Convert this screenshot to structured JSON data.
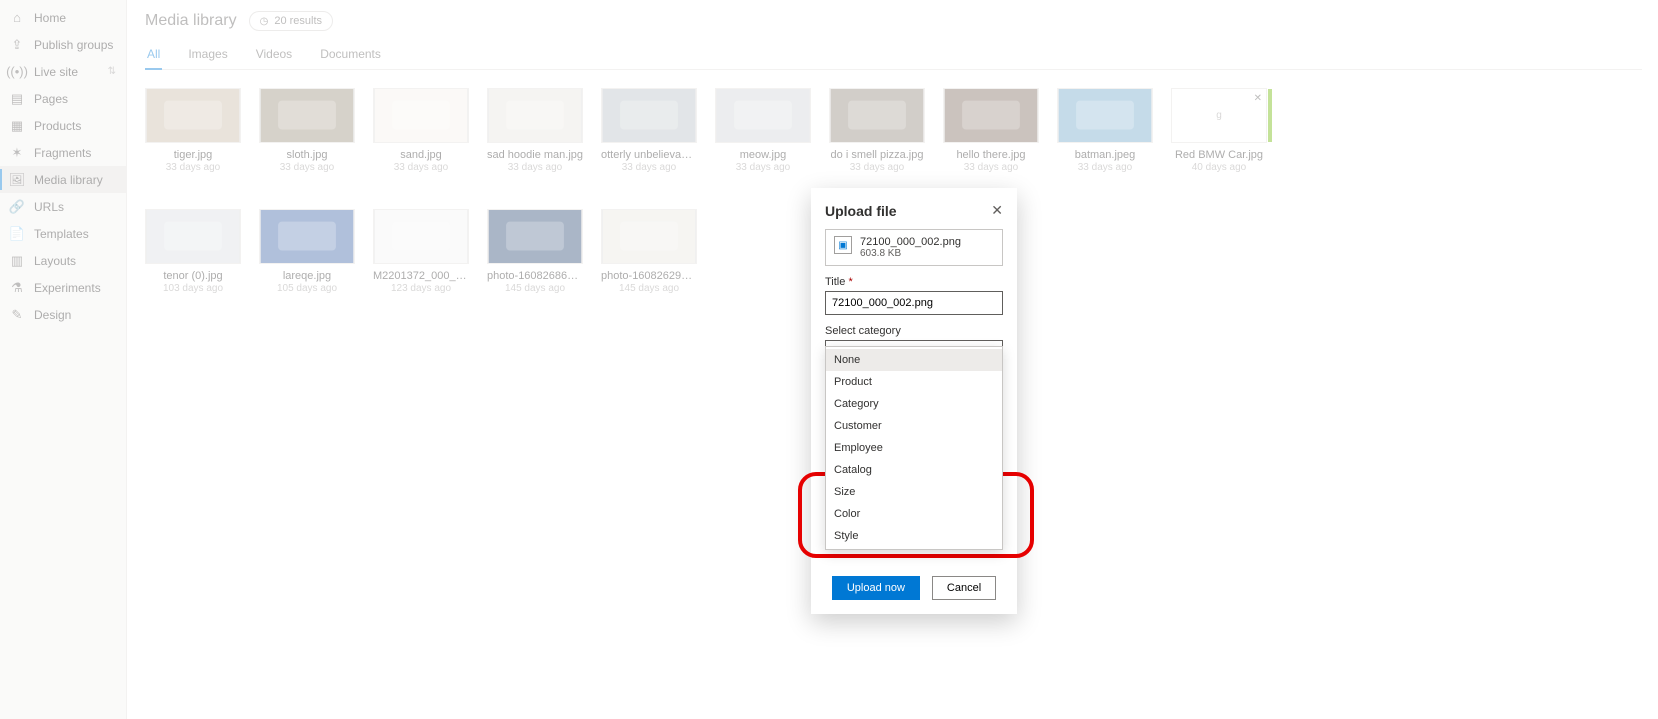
{
  "sidebar": {
    "items": [
      {
        "icon": "home-icon",
        "glyph": "⌂",
        "label": "Home"
      },
      {
        "icon": "publish-icon",
        "glyph": "⇪",
        "label": "Publish groups"
      },
      {
        "icon": "signal-icon",
        "glyph": "((•))",
        "label": "Live site",
        "hasCaret": true
      },
      {
        "icon": "page-icon",
        "glyph": "▤",
        "label": "Pages"
      },
      {
        "icon": "product-icon",
        "glyph": "▦",
        "label": "Products"
      },
      {
        "icon": "fragment-icon",
        "glyph": "✶",
        "label": "Fragments"
      },
      {
        "icon": "media-icon",
        "glyph": "🖼",
        "label": "Media library",
        "active": true
      },
      {
        "icon": "url-icon",
        "glyph": "🔗",
        "label": "URLs"
      },
      {
        "icon": "template-icon",
        "glyph": "📄",
        "label": "Templates"
      },
      {
        "icon": "layout-icon",
        "glyph": "▥",
        "label": "Layouts"
      },
      {
        "icon": "experiment-icon",
        "glyph": "⚗",
        "label": "Experiments"
      },
      {
        "icon": "design-icon",
        "glyph": "✎",
        "label": "Design"
      }
    ]
  },
  "header": {
    "title": "Media library",
    "resultChip": "20 results"
  },
  "tabs": [
    {
      "label": "All",
      "active": true
    },
    {
      "label": "Images"
    },
    {
      "label": "Videos"
    },
    {
      "label": "Documents"
    }
  ],
  "items": [
    {
      "name": "tiger.jpg",
      "meta": "33 days ago",
      "bg": "#c8b9a6"
    },
    {
      "name": "sloth.jpg",
      "meta": "33 days ago",
      "bg": "#9a8e7b"
    },
    {
      "name": "sand.jpg",
      "meta": "33 days ago",
      "bg": "#f4f1ea"
    },
    {
      "name": "sad hoodie man.jpg",
      "meta": "33 days ago",
      "bg": "#e7e4de"
    },
    {
      "name": "otterly unbelievable.j...",
      "meta": "33 days ago",
      "bg": "#b7bfc5"
    },
    {
      "name": "meow.jpg",
      "meta": "33 days ago",
      "bg": "#cfd3d6"
    },
    {
      "name": "do i smell pizza.jpg",
      "meta": "33 days ago",
      "bg": "#8f8478"
    },
    {
      "name": "hello there.jpg",
      "meta": "33 days ago",
      "bg": "#7e6a5d"
    },
    {
      "name": "batman.jpeg",
      "meta": "33 days ago",
      "bg": "#6fa6c9"
    },
    {
      "name": "Red BMW Car.jpg",
      "meta": "40 days ago",
      "uploading": true
    }
  ],
  "items2": [
    {
      "name": "tenor (0).jpg",
      "meta": "103 days ago",
      "bg": "#d9dde0"
    },
    {
      "name": "lareqe.jpg",
      "meta": "105 days ago",
      "bg": "#3b63a6"
    },
    {
      "name": "M2201372_000_002.p...",
      "meta": "123 days ago",
      "bg": "#f2f2f2"
    },
    {
      "name": "photo-160826862760...",
      "meta": "145 days ago",
      "bg": "#2b4a73"
    },
    {
      "name": "photo-160826294108...",
      "meta": "145 days ago",
      "bg": "#e8e5df"
    }
  ],
  "modal": {
    "title": "Upload file",
    "file": {
      "name": "72100_000_002.png",
      "size": "603.8 KB"
    },
    "titleField": {
      "label": "Title",
      "required": "*",
      "value": "72100_000_002.png"
    },
    "categoryField": {
      "label": "Select category",
      "value": "None"
    },
    "options": [
      "None",
      "Product",
      "Category",
      "Customer",
      "Employee",
      "Catalog",
      "Size",
      "Color",
      "Style"
    ],
    "uploadBtn": "Upload now",
    "cancelBtn": "Cancel"
  }
}
